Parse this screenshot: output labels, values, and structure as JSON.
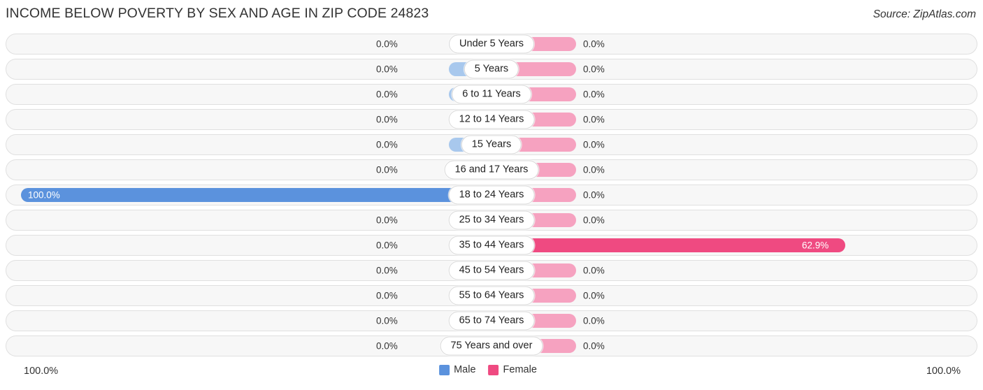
{
  "header": {
    "title": "INCOME BELOW POVERTY BY SEX AND AGE IN ZIP CODE 24823",
    "source": "Source: ZipAtlas.com"
  },
  "legend": {
    "male_label": "Male",
    "female_label": "Female"
  },
  "axis": {
    "left_label": "100.0%",
    "right_label": "100.0%"
  },
  "chart_data": {
    "type": "bar",
    "orientation": "horizontal-diverging",
    "title": "INCOME BELOW POVERTY BY SEX AND AGE IN ZIP CODE 24823",
    "xlabel": "",
    "ylabel": "",
    "xlim": [
      0,
      100
    ],
    "grid": false,
    "legend_position": "bottom-center",
    "categories": [
      "Under 5 Years",
      "5 Years",
      "6 to 11 Years",
      "12 to 14 Years",
      "15 Years",
      "16 and 17 Years",
      "18 to 24 Years",
      "25 to 34 Years",
      "35 to 44 Years",
      "45 to 54 Years",
      "55 to 64 Years",
      "65 to 74 Years",
      "75 Years and over"
    ],
    "series": [
      {
        "name": "Male",
        "color": "#5b92dd",
        "values": [
          0.0,
          0.0,
          0.0,
          0.0,
          0.0,
          0.0,
          100.0,
          0.0,
          0.0,
          0.0,
          0.0,
          0.0,
          0.0
        ],
        "labels": [
          "0.0%",
          "0.0%",
          "0.0%",
          "0.0%",
          "0.0%",
          "0.0%",
          "100.0%",
          "0.0%",
          "0.0%",
          "0.0%",
          "0.0%",
          "0.0%",
          "0.0%"
        ]
      },
      {
        "name": "Female",
        "color": "#ef4a81",
        "values": [
          0.0,
          0.0,
          0.0,
          0.0,
          0.0,
          0.0,
          0.0,
          0.0,
          62.9,
          0.0,
          0.0,
          0.0,
          0.0
        ],
        "labels": [
          "0.0%",
          "0.0%",
          "0.0%",
          "0.0%",
          "0.0%",
          "0.0%",
          "0.0%",
          "0.0%",
          "62.9%",
          "0.0%",
          "0.0%",
          "0.0%",
          "0.0%"
        ]
      }
    ]
  }
}
